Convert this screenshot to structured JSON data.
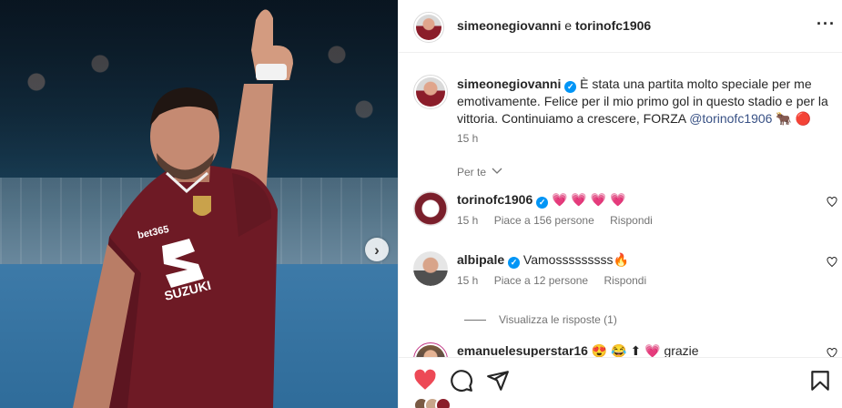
{
  "post": {
    "header": {
      "account_1": "simeonegiovanni",
      "conjunction": "e",
      "account_2": "torinofc1906",
      "more_label": "···"
    },
    "media": {
      "next_label": "›"
    },
    "caption": {
      "username": "simeonegiovanni",
      "text": "È stata una partita molto speciale per me emotivamente. Felice per il mio primo gol in questo stadio e per la vittoria. Continuiamo a crescere, FORZA ",
      "mention": "@torinofc1906",
      "emoji": "🐂 🔴",
      "time": "15 h"
    },
    "translate_label": "Per te",
    "comments": [
      {
        "username": "torinofc1906",
        "text": "💗 💗 💗 💗",
        "time": "15 h",
        "likes": "Piace a 156 persone",
        "reply": "Rispondi"
      },
      {
        "username": "albipale",
        "text": "Vamosssssssss🔥",
        "time": "15 h",
        "likes": "Piace a 12 persone",
        "reply": "Rispondi"
      },
      {
        "username": "emanuelesuperstar16",
        "text": "😍 😂 ⬆ 💗 grazie"
      }
    ],
    "view_replies": "Visualizza le risposte (1)"
  },
  "colors": {
    "accent": "#0095f6",
    "like_red": "#ed4956",
    "torino_maroon": "#7a1f2b"
  }
}
